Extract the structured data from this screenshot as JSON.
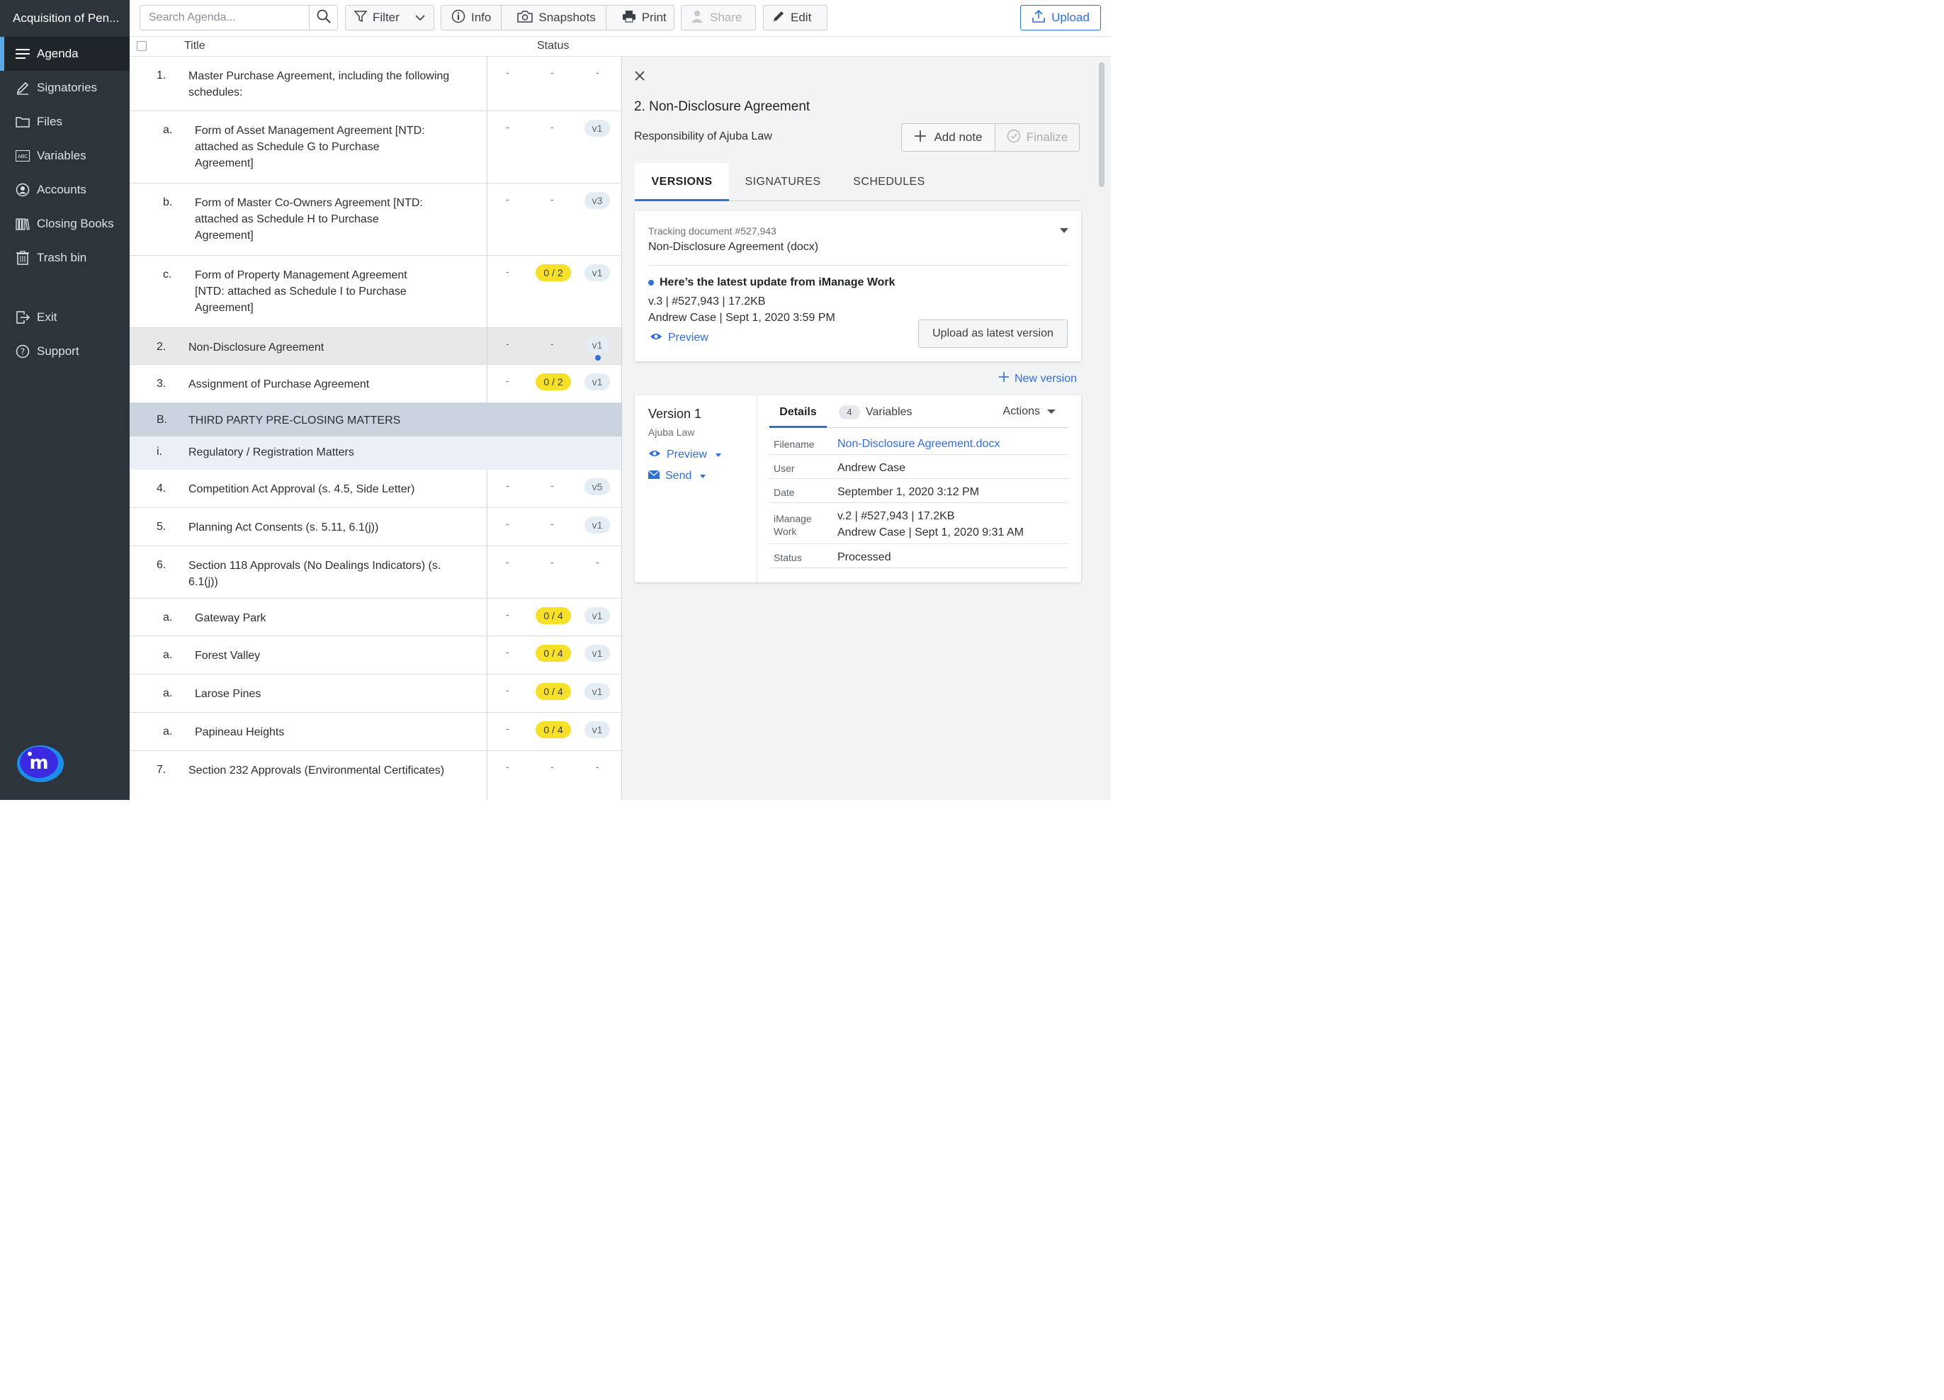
{
  "app": {
    "title": "Acquisition of Pen..."
  },
  "sidebar": {
    "items": [
      {
        "label": "Agenda",
        "icon": "agenda-lines-icon",
        "active": true
      },
      {
        "label": "Signatories",
        "icon": "pen-icon"
      },
      {
        "label": "Files",
        "icon": "folder-icon"
      },
      {
        "label": "Variables",
        "icon": "abc-icon"
      },
      {
        "label": "Accounts",
        "icon": "account-icon"
      },
      {
        "label": "Closing Books",
        "icon": "books-icon"
      },
      {
        "label": "Trash bin",
        "icon": "trash-icon"
      }
    ],
    "bottom": [
      {
        "label": "Exit",
        "icon": "exit-icon"
      },
      {
        "label": "Support",
        "icon": "help-icon"
      }
    ]
  },
  "toolbar": {
    "search_placeholder": "Search Agenda...",
    "filter_label": "Filter",
    "info_label": "Info",
    "snapshots_label": "Snapshots",
    "print_label": "Print",
    "share_label": "Share",
    "edit_label": "Edit",
    "upload_label": "Upload"
  },
  "table": {
    "col_title": "Title",
    "col_status": "Status",
    "dash": "-"
  },
  "rows": [
    {
      "num": "1.",
      "text": "Master Purchase Agreement, including the following schedules:"
    },
    {
      "num": "a.",
      "text": "Form of Asset Management Agreement [NTD: attached as Schedule G to Purchase Agreement]",
      "version": "v1"
    },
    {
      "num": "b.",
      "text": "Form of Master Co-Owners Agreement [NTD: attached as Schedule H to Purchase Agreement]",
      "version": "v3"
    },
    {
      "num": "c.",
      "text": "Form of Property Management Agreement [NTD: attached as Schedule I to Purchase Agreement]",
      "sigs": "0 / 2",
      "version": "v1"
    },
    {
      "num": "2.",
      "text": "Non-Disclosure Agreement",
      "version": "v1"
    },
    {
      "num": "3.",
      "text": "Assignment of Purchase Agreement",
      "sigs": "0 / 2",
      "version": "v1"
    },
    {
      "num": "B.",
      "text": "THIRD PARTY PRE-CLOSING MATTERS"
    },
    {
      "num": "i.",
      "text": "Regulatory / Registration Matters"
    },
    {
      "num": "4.",
      "text": "Competition Act Approval (s. 4.5, Side Letter)",
      "version": "v5"
    },
    {
      "num": "5.",
      "text": "Planning Act Consents (s. 5.11, 6.1(j))",
      "version": "v1"
    },
    {
      "num": "6.",
      "text": "Section 118 Approvals (No Dealings Indicators) (s. 6.1(j))"
    },
    {
      "num": "a.",
      "text": "Gateway Park",
      "sigs": "0 / 4",
      "version": "v1"
    },
    {
      "num": "a.",
      "text": "Forest Valley",
      "sigs": "0 / 4",
      "version": "v1"
    },
    {
      "num": "a.",
      "text": "Larose Pines",
      "sigs": "0 / 4",
      "version": "v1"
    },
    {
      "num": "a.",
      "text": "Papineau Heights",
      "sigs": "0 / 4",
      "version": "v1"
    },
    {
      "num": "7.",
      "text": "Section 232 Approvals (Environmental Certificates)"
    }
  ],
  "panel": {
    "title": "2. Non-Disclosure Agreement",
    "responsibility": "Responsibility of Ajuba Law",
    "add_note_label": "Add note",
    "finalize_label": "Finalize",
    "tabs": [
      "VERSIONS",
      "SIGNATURES",
      "SCHEDULES"
    ],
    "tracking": {
      "label": "Tracking document #527,943",
      "doc": "Non-Disclosure Agreement (docx)",
      "update_title": "Here’s the latest update from iManage Work",
      "line1": "v.3  |  #527,943  |  17.2KB",
      "line2": "Andrew Case | Sept 1, 2020 3:59 PM",
      "preview_label": "Preview",
      "upload_latest_label": "Upload as latest version"
    },
    "new_version_label": "New version",
    "version": {
      "title": "Version 1",
      "owner": "Ajuba Law",
      "preview_label": "Preview",
      "send_label": "Send",
      "details_tab": "Details",
      "variables_count": "4",
      "variables_tab": "Variables",
      "actions_label": "Actions",
      "details": {
        "filename_key": "Filename",
        "filename": "Non-Disclosure Agreement.docx",
        "user_key": "User",
        "user": "Andrew Case",
        "date_key": "Date",
        "date": "September 1, 2020 3:12 PM",
        "imanage_key_1": "iManage",
        "imanage_key_2": "Work",
        "imanage_1": "v.2  |  #527,943  |  17.2KB",
        "imanage_2": "Andrew Case | Sept 1, 2020 9:31 AM",
        "status_key": "Status",
        "status": "Processed"
      }
    }
  },
  "colors": {
    "accent": "#2f6fd6",
    "sidebar": "#2d343c",
    "pill_yellow": "#f6e02a",
    "pill_version": "#e3edf3"
  }
}
